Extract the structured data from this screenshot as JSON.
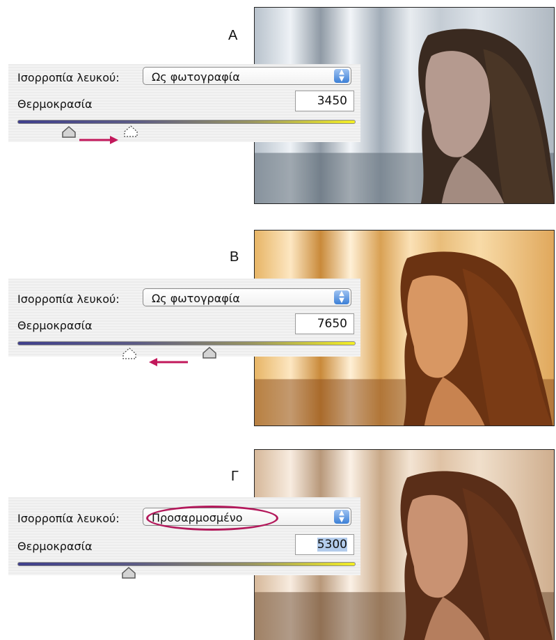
{
  "panels": [
    {
      "letter": "A",
      "wb_label": "Ισορροπία λευκού:",
      "wb_value": "Ως φωτογραφία",
      "temp_label": "Θερμοκρασία",
      "temp_value": "3450",
      "arrow_direction": "right",
      "photo_tone": "cool"
    },
    {
      "letter": "B",
      "wb_label": "Ισορροπία λευκού:",
      "wb_value": "Ως φωτογραφία",
      "temp_label": "Θερμοκρασία",
      "temp_value": "7650",
      "arrow_direction": "left",
      "photo_tone": "warm"
    },
    {
      "letter": "Γ",
      "wb_label": "Ισορροπία λευκού:",
      "wb_value": "Προσαρμοσμένο",
      "temp_label": "Θερμοκρασία",
      "temp_value": "5300",
      "arrow_direction": "none",
      "photo_tone": "neutral-warm"
    }
  ],
  "colors": {
    "arrow": "#c2185b",
    "highlight_circle": "#b3195b",
    "select_stepper": "#3c7fd6",
    "slider_cool": "#3f3f8c",
    "slider_warm": "#f4ef24"
  },
  "icons": {
    "select_stepper": "updown-stepper-icon",
    "slider_thumb": "slider-thumb-icon",
    "ghost_thumb": "ghost-thumb-icon",
    "drag_arrow": "arrow-icon"
  }
}
